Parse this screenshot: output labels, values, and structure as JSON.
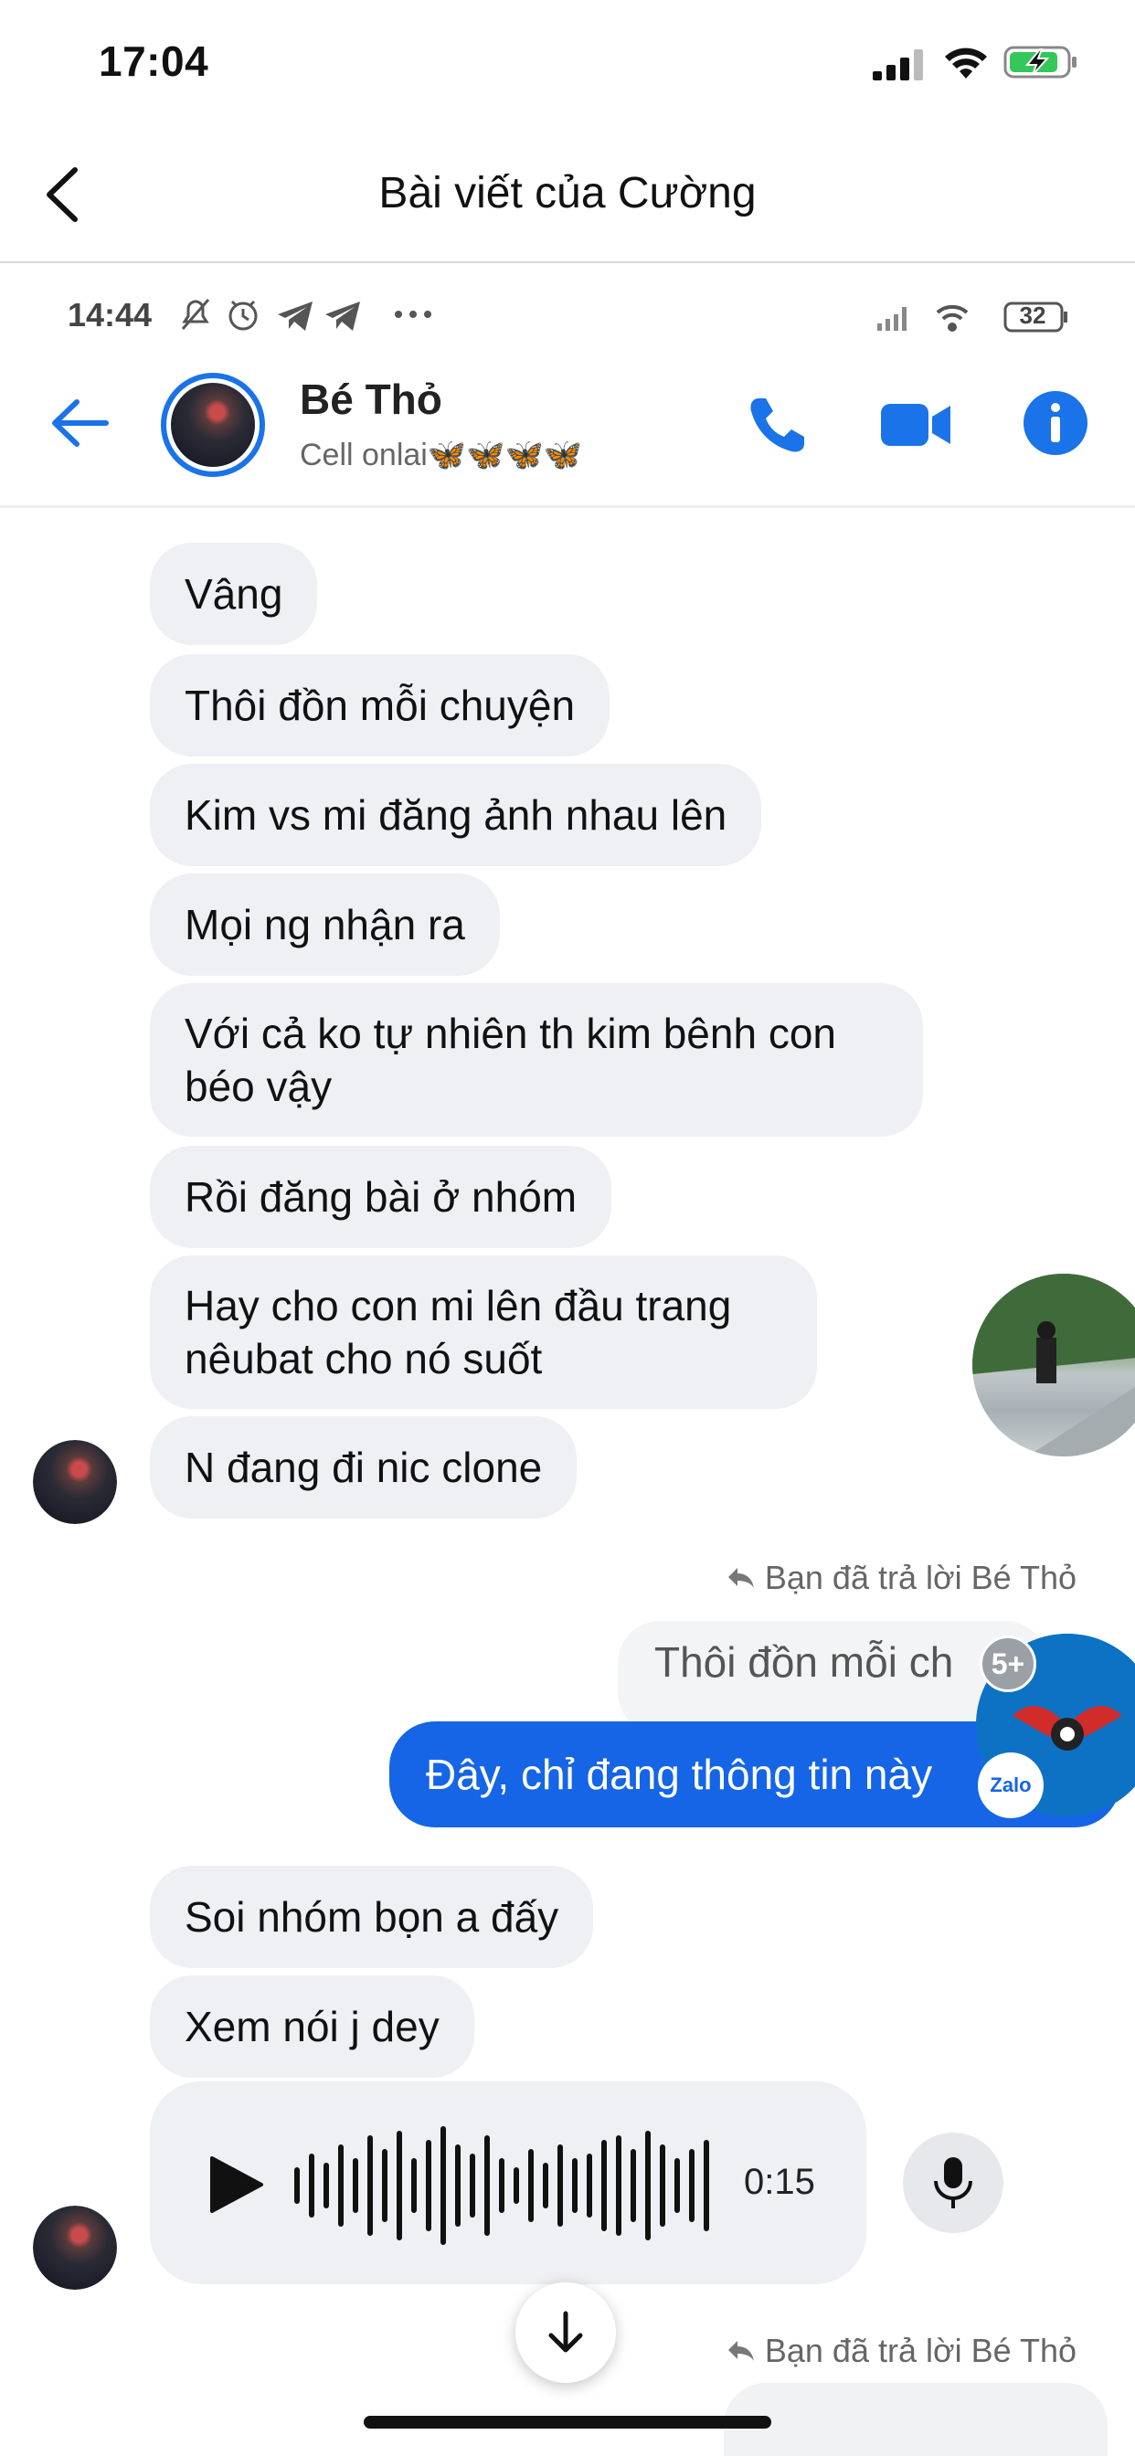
{
  "ios_status": {
    "time": "17:04"
  },
  "outer_nav": {
    "title": "Bài viết của Cường"
  },
  "android_status": {
    "time": "14:44",
    "battery": "32"
  },
  "messenger": {
    "contact_name": "Bé Thỏ",
    "status": "Cell onlai🦋🦋🦋🦋",
    "accent_color": "#1565e6"
  },
  "messages_in_1": [
    "Vâng",
    "Thôi đồn mỗi chuyện",
    "Kim vs mi đăng ảnh nhau lên",
    "Mọi ng nhận ra",
    "Với cả ko tự nhiên th kim bênh con béo vậy",
    "Rồi đăng bài ở nhóm",
    "Hay cho con mi lên đầu trang nêubat cho nó suốt",
    "N đang đi nic clone"
  ],
  "reply_note": "Bạn đã trả lời Bé Thỏ",
  "quoted_message": "Thôi đồn mỗi ch",
  "outgoing_message": "Đây, chỉ đang thông tin này",
  "badge_count": "5+",
  "zalo_label": "Zalo",
  "messages_in_2": [
    "Soi nhóm bọn a đấy",
    "Xem nói j dey"
  ],
  "voice_message": {
    "duration": "0:15"
  },
  "reply_note_2": "Bạn đã trả lời Bé Thỏ",
  "icons": [
    "back-chevron-icon",
    "signal-icon",
    "wifi-icon",
    "battery-charging-icon",
    "mute-icon",
    "alarm-icon",
    "telegram-icon",
    "more-icon",
    "arrow-left-icon",
    "phone-icon",
    "video-icon",
    "info-icon",
    "reply-icon",
    "play-icon",
    "mic-icon",
    "arrow-down-icon"
  ]
}
